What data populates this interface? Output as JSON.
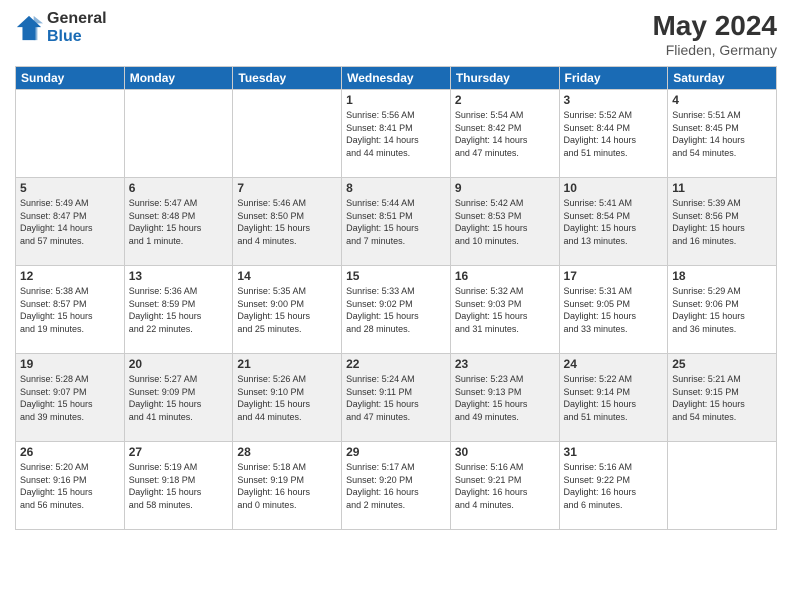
{
  "header": {
    "logo_general": "General",
    "logo_blue": "Blue",
    "month_year": "May 2024",
    "location": "Flieden, Germany"
  },
  "weekdays": [
    "Sunday",
    "Monday",
    "Tuesday",
    "Wednesday",
    "Thursday",
    "Friday",
    "Saturday"
  ],
  "weeks": [
    [
      {
        "day": "",
        "info": ""
      },
      {
        "day": "",
        "info": ""
      },
      {
        "day": "",
        "info": ""
      },
      {
        "day": "1",
        "info": "Sunrise: 5:56 AM\nSunset: 8:41 PM\nDaylight: 14 hours\nand 44 minutes."
      },
      {
        "day": "2",
        "info": "Sunrise: 5:54 AM\nSunset: 8:42 PM\nDaylight: 14 hours\nand 47 minutes."
      },
      {
        "day": "3",
        "info": "Sunrise: 5:52 AM\nSunset: 8:44 PM\nDaylight: 14 hours\nand 51 minutes."
      },
      {
        "day": "4",
        "info": "Sunrise: 5:51 AM\nSunset: 8:45 PM\nDaylight: 14 hours\nand 54 minutes."
      }
    ],
    [
      {
        "day": "5",
        "info": "Sunrise: 5:49 AM\nSunset: 8:47 PM\nDaylight: 14 hours\nand 57 minutes."
      },
      {
        "day": "6",
        "info": "Sunrise: 5:47 AM\nSunset: 8:48 PM\nDaylight: 15 hours\nand 1 minute."
      },
      {
        "day": "7",
        "info": "Sunrise: 5:46 AM\nSunset: 8:50 PM\nDaylight: 15 hours\nand 4 minutes."
      },
      {
        "day": "8",
        "info": "Sunrise: 5:44 AM\nSunset: 8:51 PM\nDaylight: 15 hours\nand 7 minutes."
      },
      {
        "day": "9",
        "info": "Sunrise: 5:42 AM\nSunset: 8:53 PM\nDaylight: 15 hours\nand 10 minutes."
      },
      {
        "day": "10",
        "info": "Sunrise: 5:41 AM\nSunset: 8:54 PM\nDaylight: 15 hours\nand 13 minutes."
      },
      {
        "day": "11",
        "info": "Sunrise: 5:39 AM\nSunset: 8:56 PM\nDaylight: 15 hours\nand 16 minutes."
      }
    ],
    [
      {
        "day": "12",
        "info": "Sunrise: 5:38 AM\nSunset: 8:57 PM\nDaylight: 15 hours\nand 19 minutes."
      },
      {
        "day": "13",
        "info": "Sunrise: 5:36 AM\nSunset: 8:59 PM\nDaylight: 15 hours\nand 22 minutes."
      },
      {
        "day": "14",
        "info": "Sunrise: 5:35 AM\nSunset: 9:00 PM\nDaylight: 15 hours\nand 25 minutes."
      },
      {
        "day": "15",
        "info": "Sunrise: 5:33 AM\nSunset: 9:02 PM\nDaylight: 15 hours\nand 28 minutes."
      },
      {
        "day": "16",
        "info": "Sunrise: 5:32 AM\nSunset: 9:03 PM\nDaylight: 15 hours\nand 31 minutes."
      },
      {
        "day": "17",
        "info": "Sunrise: 5:31 AM\nSunset: 9:05 PM\nDaylight: 15 hours\nand 33 minutes."
      },
      {
        "day": "18",
        "info": "Sunrise: 5:29 AM\nSunset: 9:06 PM\nDaylight: 15 hours\nand 36 minutes."
      }
    ],
    [
      {
        "day": "19",
        "info": "Sunrise: 5:28 AM\nSunset: 9:07 PM\nDaylight: 15 hours\nand 39 minutes."
      },
      {
        "day": "20",
        "info": "Sunrise: 5:27 AM\nSunset: 9:09 PM\nDaylight: 15 hours\nand 41 minutes."
      },
      {
        "day": "21",
        "info": "Sunrise: 5:26 AM\nSunset: 9:10 PM\nDaylight: 15 hours\nand 44 minutes."
      },
      {
        "day": "22",
        "info": "Sunrise: 5:24 AM\nSunset: 9:11 PM\nDaylight: 15 hours\nand 47 minutes."
      },
      {
        "day": "23",
        "info": "Sunrise: 5:23 AM\nSunset: 9:13 PM\nDaylight: 15 hours\nand 49 minutes."
      },
      {
        "day": "24",
        "info": "Sunrise: 5:22 AM\nSunset: 9:14 PM\nDaylight: 15 hours\nand 51 minutes."
      },
      {
        "day": "25",
        "info": "Sunrise: 5:21 AM\nSunset: 9:15 PM\nDaylight: 15 hours\nand 54 minutes."
      }
    ],
    [
      {
        "day": "26",
        "info": "Sunrise: 5:20 AM\nSunset: 9:16 PM\nDaylight: 15 hours\nand 56 minutes."
      },
      {
        "day": "27",
        "info": "Sunrise: 5:19 AM\nSunset: 9:18 PM\nDaylight: 15 hours\nand 58 minutes."
      },
      {
        "day": "28",
        "info": "Sunrise: 5:18 AM\nSunset: 9:19 PM\nDaylight: 16 hours\nand 0 minutes."
      },
      {
        "day": "29",
        "info": "Sunrise: 5:17 AM\nSunset: 9:20 PM\nDaylight: 16 hours\nand 2 minutes."
      },
      {
        "day": "30",
        "info": "Sunrise: 5:16 AM\nSunset: 9:21 PM\nDaylight: 16 hours\nand 4 minutes."
      },
      {
        "day": "31",
        "info": "Sunrise: 5:16 AM\nSunset: 9:22 PM\nDaylight: 16 hours\nand 6 minutes."
      },
      {
        "day": "",
        "info": ""
      }
    ]
  ]
}
